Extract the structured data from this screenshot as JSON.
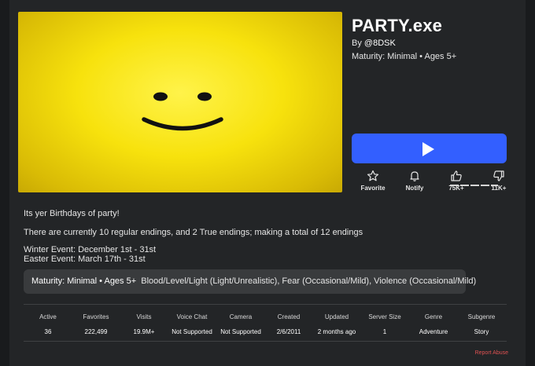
{
  "game": {
    "title": "PARTY.exe",
    "by_prefix": "By",
    "creator": "@8DSK",
    "maturity_line": "Maturity: Minimal • Ages 5+"
  },
  "actions": {
    "favorite_label": "Favorite",
    "notify_label": "Notify",
    "likes": "75K+",
    "dislikes": "11K+",
    "icons": [
      "star-icon",
      "bell-icon",
      "thumbs-up-icon",
      "thumbs-down-icon",
      "play-icon"
    ]
  },
  "description": {
    "line1": "Its yer Birthdays of party!",
    "line2": "There are currently 10 regular endings, and 2 True endings; making a total of 12 endings",
    "line3": "Winter Event: December 1st - 31st",
    "line4": "Easter Event: March 17th - 31st"
  },
  "maturity_box": {
    "label": "Maturity: Minimal • Ages 5+",
    "descriptors": "Blood/Level/Light (Light/Unrealistic), Fear (Occasional/Mild), Violence (Occasional/Mild)"
  },
  "stats": {
    "headers": [
      "Active",
      "Favorites",
      "Visits",
      "Voice Chat",
      "Camera",
      "Created",
      "Updated",
      "Server Size",
      "Genre",
      "Subgenre"
    ],
    "values": [
      "36",
      "222,499",
      "19.9M+",
      "Not Supported",
      "Not Supported",
      "2/6/2011",
      "2 months ago",
      "1",
      "Adventure",
      "Story"
    ]
  },
  "report_label": "Report Abuse",
  "colors": {
    "background": "#232527",
    "play_button": "#335fff",
    "thumbnail_yellow": "#f7e20d",
    "report_link": "#e05252"
  }
}
